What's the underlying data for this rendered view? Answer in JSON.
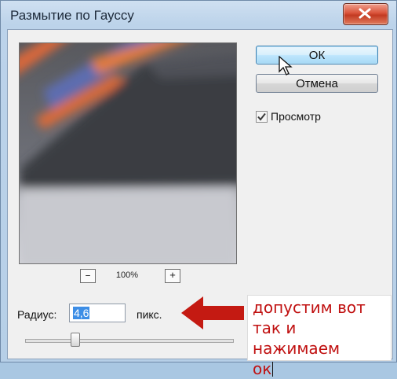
{
  "window": {
    "title": "Размытие по Гауссу"
  },
  "buttons": {
    "ok": "ОК",
    "cancel": "Отмена"
  },
  "preview_toggle": {
    "label": "Просмотр",
    "checked": true
  },
  "zoom": {
    "out": "–",
    "in": "+",
    "level": "100%"
  },
  "radius": {
    "label": "Радиус:",
    "value": "4,6",
    "unit": "пикс."
  },
  "annotation": {
    "lines": [
      "допустим вот",
      "так и нажимаем",
      "ок"
    ],
    "color": "#c01010"
  },
  "colors": {
    "arrow": "#c41a12",
    "ok_button": "#bee6fd",
    "close_button": "#c33a22"
  },
  "icons": [
    "close-icon",
    "mouse-pointer-icon",
    "check-icon",
    "arrow-left-icon"
  ]
}
